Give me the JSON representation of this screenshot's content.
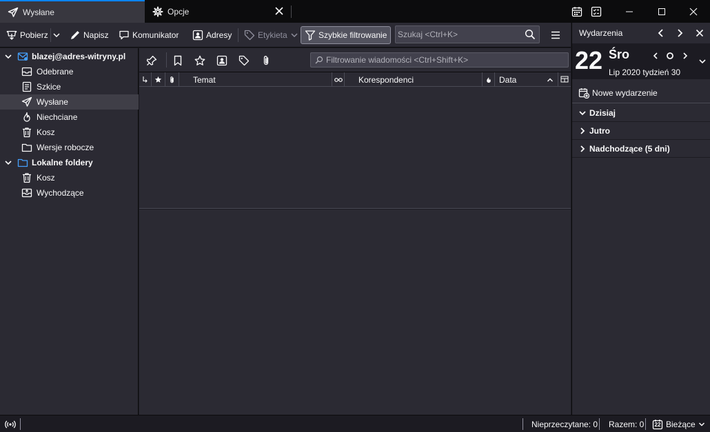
{
  "tabs": [
    {
      "label": "Wysłane",
      "icon": "send-icon",
      "active": true
    },
    {
      "label": "Opcje",
      "icon": "gear-icon",
      "active": false
    }
  ],
  "toolbar": {
    "get_messages": "Pobierz",
    "write": "Napisz",
    "chat": "Komunikator",
    "address_book": "Adresy",
    "tag": "Etykieta",
    "quick_filter": "Szybkie filtrowanie",
    "search_placeholder": "Szukaj <Ctrl+K>"
  },
  "folders": {
    "account": "blazej@adres-witryny.pl",
    "items": [
      {
        "label": "Odebrane",
        "icon": "inbox-icon"
      },
      {
        "label": "Szkice",
        "icon": "drafts-icon"
      },
      {
        "label": "Wysłane",
        "icon": "send-icon",
        "selected": true
      },
      {
        "label": "Niechciane",
        "icon": "junk-icon"
      },
      {
        "label": "Kosz",
        "icon": "trash-icon"
      },
      {
        "label": "Wersje robocze",
        "icon": "folder-icon"
      }
    ],
    "local": "Lokalne foldery",
    "local_items": [
      {
        "label": "Kosz",
        "icon": "trash-icon"
      },
      {
        "label": "Wychodzące",
        "icon": "outbox-icon"
      }
    ]
  },
  "quickfilter": {
    "placeholder": "Filtrowanie wiadomości <Ctrl+Shift+K>"
  },
  "columns": {
    "subject": "Temat",
    "correspondents": "Korespondenci",
    "date": "Data"
  },
  "today_pane": {
    "title": "Wydarzenia",
    "day_number": "22",
    "day_name": "Śro",
    "month_week": "Lip 2020  tydzień 30",
    "new_event": "Nowe wydarzenie",
    "sections": [
      "Dzisiaj",
      "Jutro",
      "Nadchodzące (5 dni)"
    ]
  },
  "statusbar": {
    "unread": "Nieprzeczytane: 0",
    "total": "Razem: 0",
    "today_toggle": "Bieżące",
    "calendar_day": "22"
  }
}
